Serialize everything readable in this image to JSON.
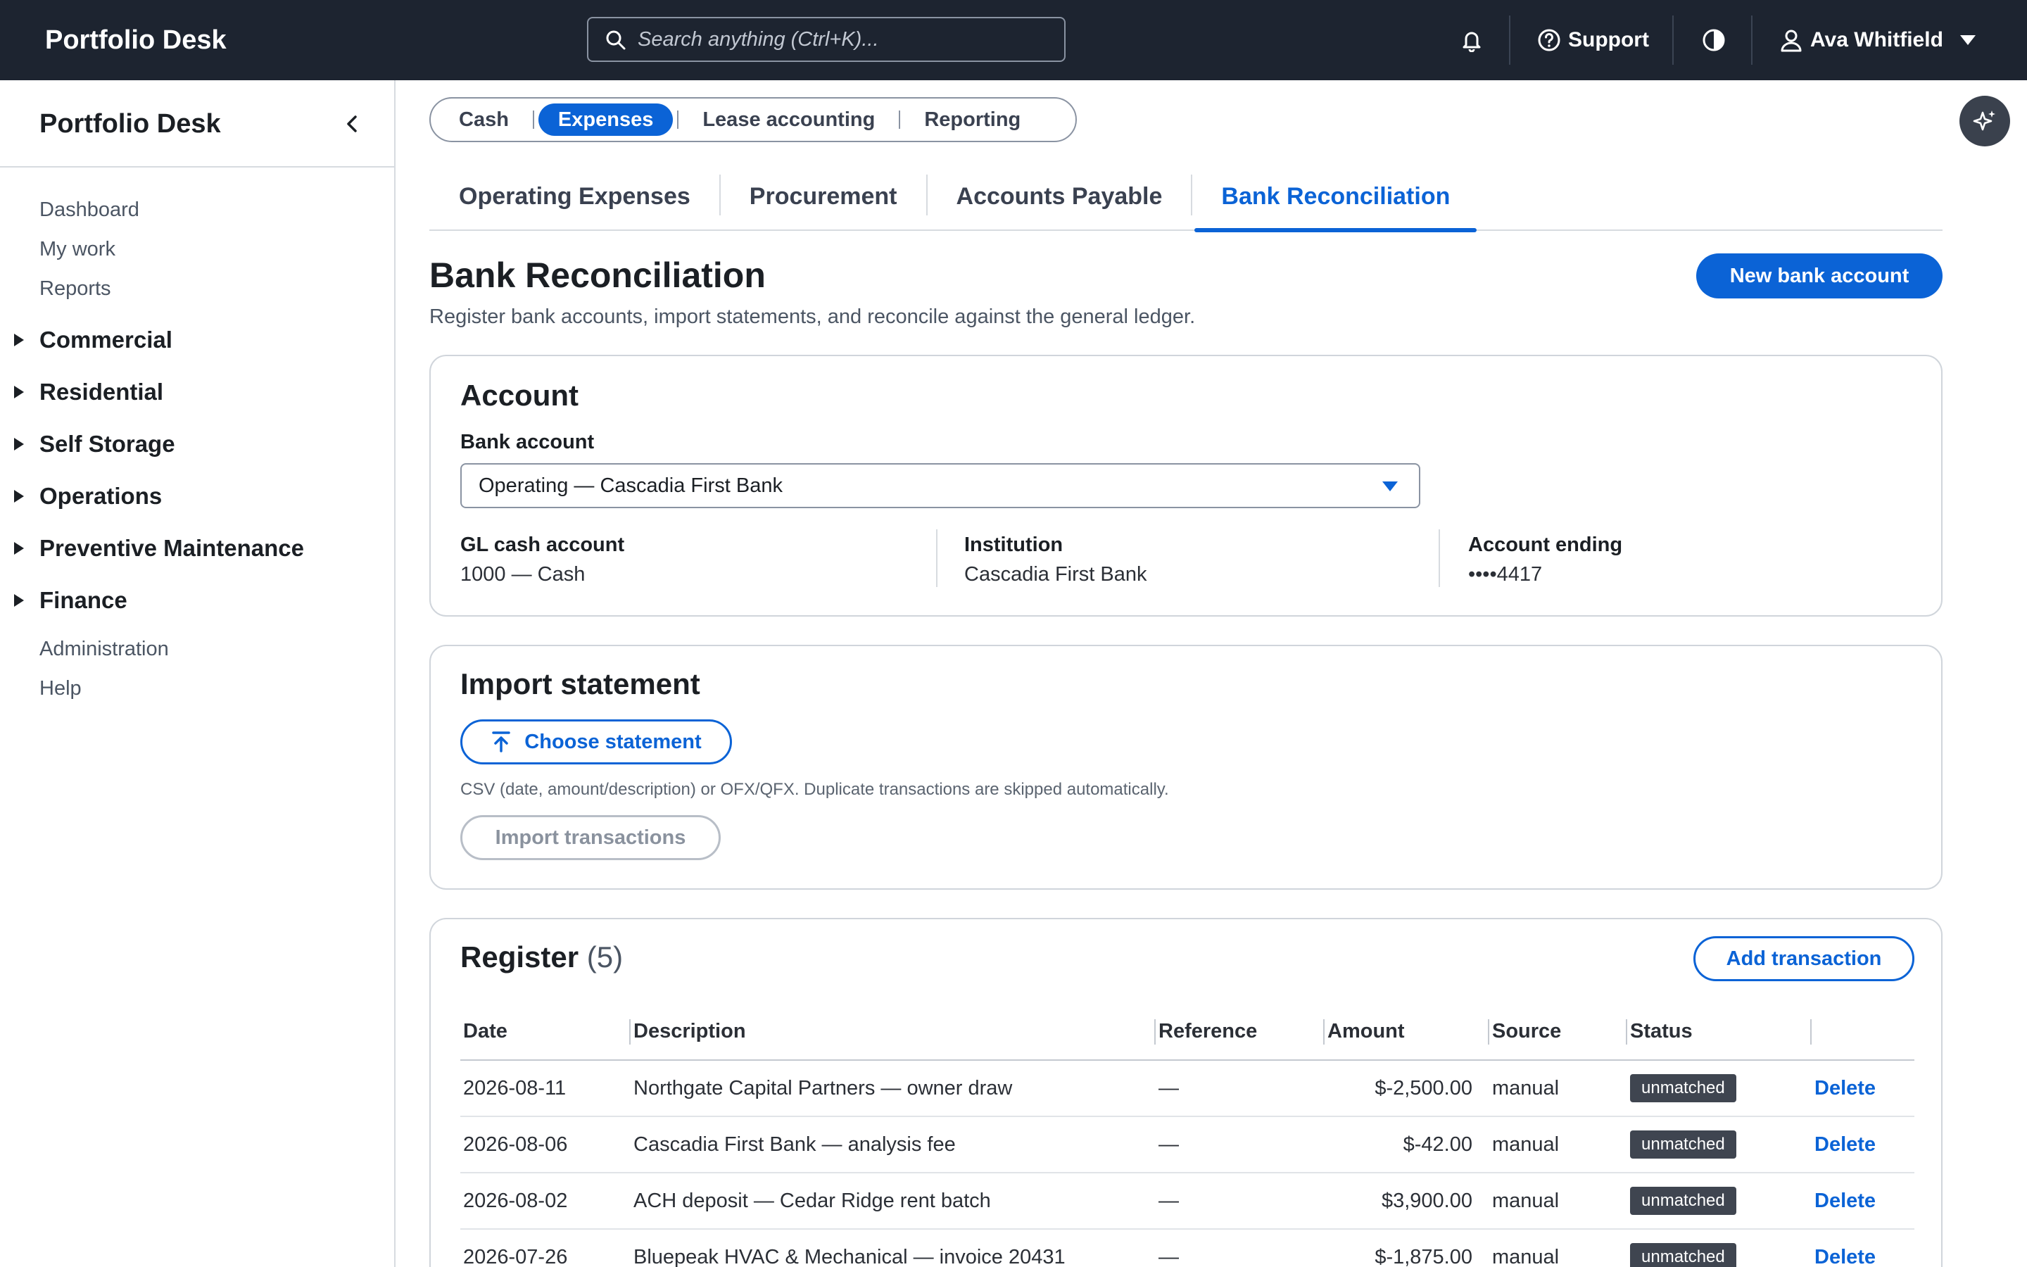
{
  "app": {
    "title": "Portfolio Desk"
  },
  "topbar": {
    "search_placeholder": "Search anything (Ctrl+K)...",
    "support_label": "Support",
    "user_name": "Ava Whitfield"
  },
  "sidebar": {
    "title": "Portfolio Desk",
    "top_items": [
      "Dashboard",
      "My work",
      "Reports"
    ],
    "groups": [
      "Commercial",
      "Residential",
      "Self Storage",
      "Operations",
      "Preventive Maintenance",
      "Finance"
    ],
    "bottom_items": [
      "Administration",
      "Help"
    ]
  },
  "module_tabs": [
    "Cash",
    "Expenses",
    "Lease accounting",
    "Reporting"
  ],
  "module_tabs_active": "Expenses",
  "sub_tabs": [
    "Operating Expenses",
    "Procurement",
    "Accounts Payable",
    "Bank Reconciliation"
  ],
  "sub_tabs_active": "Bank Reconciliation",
  "page": {
    "title": "Bank Reconciliation",
    "subtitle": "Register bank accounts, import statements, and reconcile against the general ledger.",
    "new_button": "New bank account"
  },
  "account_card": {
    "title": "Account",
    "bank_account_label": "Bank account",
    "bank_account_value": "Operating — Cascadia First Bank",
    "gl_label": "GL cash account",
    "gl_value": "1000 — Cash",
    "institution_label": "Institution",
    "institution_value": "Cascadia First Bank",
    "ending_label": "Account ending",
    "ending_value": "••••4417"
  },
  "import_card": {
    "title": "Import statement",
    "choose_button": "Choose statement",
    "hint": "CSV (date, amount/description) or OFX/QFX. Duplicate transactions are skipped automatically.",
    "import_button": "Import transactions"
  },
  "register": {
    "title": "Register",
    "count": "(5)",
    "add_button": "Add transaction",
    "columns": [
      "Date",
      "Description",
      "Reference",
      "Amount",
      "Source",
      "Status",
      ""
    ],
    "rows": [
      {
        "date": "2026-08-11",
        "description": "Northgate Capital Partners — owner draw",
        "reference": "—",
        "amount": "$-2,500.00",
        "negative": true,
        "source": "manual",
        "status": "unmatched",
        "action": "Delete"
      },
      {
        "date": "2026-08-06",
        "description": "Cascadia First Bank — analysis fee",
        "reference": "—",
        "amount": "$-42.00",
        "negative": true,
        "source": "manual",
        "status": "unmatched",
        "action": "Delete"
      },
      {
        "date": "2026-08-02",
        "description": "ACH deposit — Cedar Ridge rent batch",
        "reference": "—",
        "amount": "$3,900.00",
        "negative": false,
        "source": "manual",
        "status": "unmatched",
        "action": "Delete"
      },
      {
        "date": "2026-07-26",
        "description": "Bluepeak HVAC & Mechanical — invoice 20431",
        "reference": "—",
        "amount": "$-1,875.00",
        "negative": true,
        "source": "manual",
        "status": "unmatched",
        "action": "Delete"
      }
    ]
  },
  "colors": {
    "primary": "#0b63d6",
    "topbar": "#1d2430",
    "negative": "#d0101c",
    "badge": "#3f4550"
  }
}
